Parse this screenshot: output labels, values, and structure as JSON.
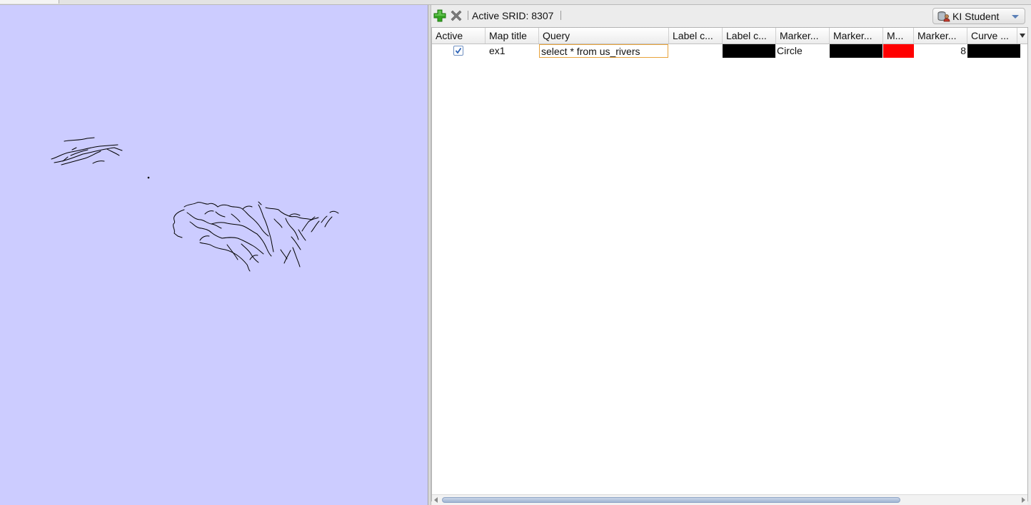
{
  "toolbar": {
    "add_icon": "add-plus-icon",
    "remove_icon": "remove-x-icon",
    "srid_text": "Active SRID: 8307",
    "connection_label": "KI Student",
    "connection_icon": "database-user-icon"
  },
  "table": {
    "columns": [
      "Active",
      "Map title",
      "Query",
      "Label c...",
      "Label c...",
      "Marker...",
      "Marker...",
      "M...",
      "Marker...",
      "Curve ..."
    ],
    "rows": [
      {
        "active": true,
        "map_title": "ex1",
        "query": "select * from us_rivers",
        "label_column": "",
        "label_color": "#000000",
        "marker_type": "Circle",
        "marker_color": "#000000",
        "marker_fill_color": "#ff0000",
        "marker_size": "8",
        "curve_color": "#000000"
      }
    ]
  },
  "map": {
    "background": "#ccccff",
    "feature_color": "#000000",
    "layer": "us_rivers"
  },
  "colors": {
    "add_icon": "#2e9e1f",
    "remove_icon": "#7a7a7a",
    "selection_border": "#e8a33a"
  }
}
